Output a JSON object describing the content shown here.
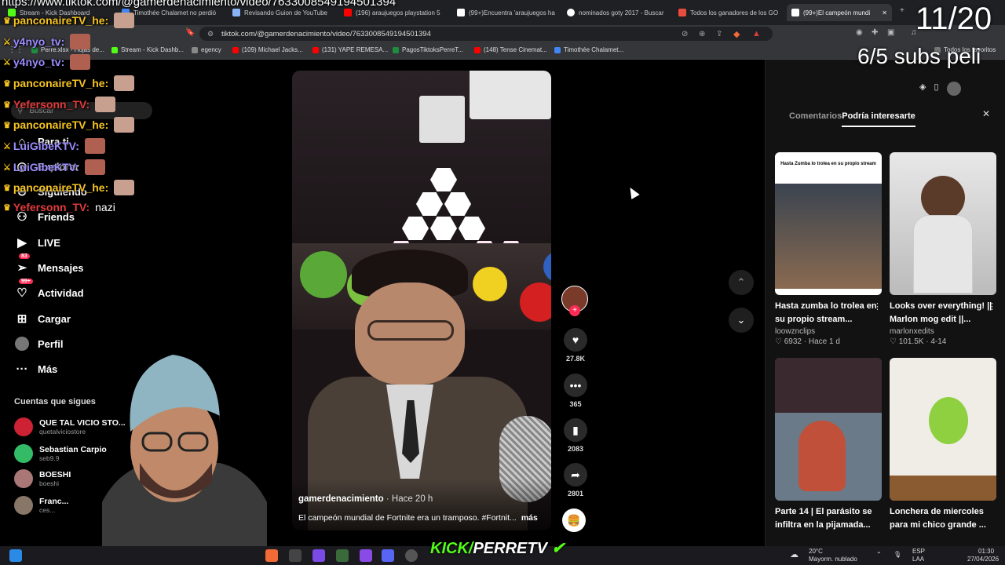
{
  "overlay": {
    "url_text": "https://www.tiktok.com/@gamerdenacimiento/video/76330085491945013​94",
    "counter": "11/20",
    "subs": "6/5 subs peli",
    "brand_left": "KICK/",
    "brand_right": "PERRETV"
  },
  "browser": {
    "tabs": [
      {
        "label": "Stream - Kick Dashboard",
        "color": "#53fc18"
      },
      {
        "label": "Timothée Chalamet no perdió",
        "color": "#4285f4"
      },
      {
        "label": "Revisando Guion de YouTube",
        "color": "#8ab4f8"
      },
      {
        "label": "(196) araujuegos playstation 5",
        "color": "#ff0000"
      },
      {
        "label": "(99+)Encuentra 'araujuegos ha",
        "color": "#ffffff"
      },
      {
        "label": "nominados goty 2017 - Buscar",
        "color": "#ffffff"
      },
      {
        "label": "Todos los ganadores de los GO",
        "color": "#e84c3d"
      },
      {
        "label": "(99+)El campeón mundi",
        "color": "#ffffff"
      }
    ],
    "url": "tiktok.com/@gamerdenacimiento/video/7633008549194501394",
    "bookmarks": [
      {
        "label": "Perre.xlsx - Hojas de...",
        "color": "#1e8e3e"
      },
      {
        "label": "Stream - Kick Dashb...",
        "color": "#53fc18"
      },
      {
        "label": "egency",
        "color": "#888888"
      },
      {
        "label": "(109) Michael Jacks...",
        "color": "#ff0000"
      },
      {
        "label": "(131) YAPE REMESA...",
        "color": "#ff0000"
      },
      {
        "label": "PagosTiktoksPerreT...",
        "color": "#1e8e3e"
      },
      {
        "label": "(148) Tense Cinemat...",
        "color": "#ff0000"
      },
      {
        "label": "Timothée Chalamet...",
        "color": "#4285f4"
      }
    ],
    "favorites": "Todos los favoritos"
  },
  "nav": {
    "search_placeholder": "Buscar",
    "items": [
      {
        "label": "Para ti",
        "icon": "home-icon"
      },
      {
        "label": "Explorar",
        "icon": "compass-icon"
      },
      {
        "label": "Siguiendo",
        "icon": "following-icon"
      },
      {
        "label": "Friends",
        "icon": "friends-icon"
      },
      {
        "label": "LIVE",
        "icon": "live-icon"
      },
      {
        "label": "Mensajes",
        "icon": "messages-icon",
        "badge": "83"
      },
      {
        "label": "Actividad",
        "icon": "activity-icon",
        "badge": "99+"
      },
      {
        "label": "Cargar",
        "icon": "upload-icon"
      },
      {
        "label": "Perfil",
        "icon": "profile-icon"
      },
      {
        "label": "Más",
        "icon": "more-icon"
      }
    ],
    "following_title": "Cuentas que sigues",
    "following": [
      {
        "name": "QUE TAL VICIO STO...",
        "handle": "quetalviciostore"
      },
      {
        "name": "Sebastian Carpio",
        "handle": "seb9.9"
      },
      {
        "name": "BOESHI",
        "handle": "boeshi"
      },
      {
        "name": "Franc...",
        "handle": "ces..."
      }
    ]
  },
  "video": {
    "author": "gamerdenacimiento",
    "time": "· Hace 20 h",
    "caption": "El campeón mundial de Fortnite era un tramposo. #Fortnit...",
    "more": "más",
    "likes": "27.8K",
    "comments": "365",
    "saves": "2083",
    "shares": "2801"
  },
  "panel": {
    "tab_comments": "Comentarios",
    "tab_suggested": "Podría interesarte",
    "cards": [
      {
        "title": "Hasta zumba lo trolea en su propio stream...",
        "user": "loowznclips",
        "likes": "6932",
        "date": "· Hace 1 d",
        "thumb_caption": "Hasta Zumba lo trolea en su propio stream"
      },
      {
        "title": "Looks over everything! || Marlon mog edit ||...",
        "user": "marlonxedits",
        "likes": "101.5K",
        "date": "· 4-14",
        "thumb_caption": ""
      },
      {
        "title": "Parte 14 | El parásito se infiltra en la pijamada...",
        "user": "",
        "likes": "",
        "date": "",
        "thumb_caption": ""
      },
      {
        "title": "Lonchera de miercoles para mi chico grande ...",
        "user": "",
        "likes": "",
        "date": "",
        "thumb_caption": ""
      }
    ]
  },
  "chat": [
    {
      "user": "panconaireTV_he:",
      "color": "#f6c420",
      "msg": ""
    },
    {
      "user": "y4nyo_tv:",
      "color": "#9b8cff",
      "msg": ""
    },
    {
      "user": "y4nyo_tv:",
      "color": "#9b8cff",
      "msg": ""
    },
    {
      "user": "panconaireTV_he:",
      "color": "#f6c420",
      "msg": ""
    },
    {
      "user": "Yefersonn_TV:",
      "color": "#e23b3b",
      "msg": ""
    },
    {
      "user": "panconaireTV_he:",
      "color": "#f6c420",
      "msg": ""
    },
    {
      "user": "LuiGibeKTV:",
      "color": "#9b8cff",
      "msg": ""
    },
    {
      "user": "LuiGibeKTV:",
      "color": "#9b8cff",
      "msg": ""
    },
    {
      "user": "panconaireTV_he:",
      "color": "#f6c420",
      "msg": ""
    },
    {
      "user": "Yefersonn_TV:",
      "color": "#e23b3b",
      "msg": "nazi"
    }
  ],
  "taskbar": {
    "weather_temp": "20°C",
    "weather_desc": "Mayorm. nublado",
    "lang": "ESP",
    "lang2": "LAA",
    "time": "01:30",
    "date": "27/04/2026"
  }
}
